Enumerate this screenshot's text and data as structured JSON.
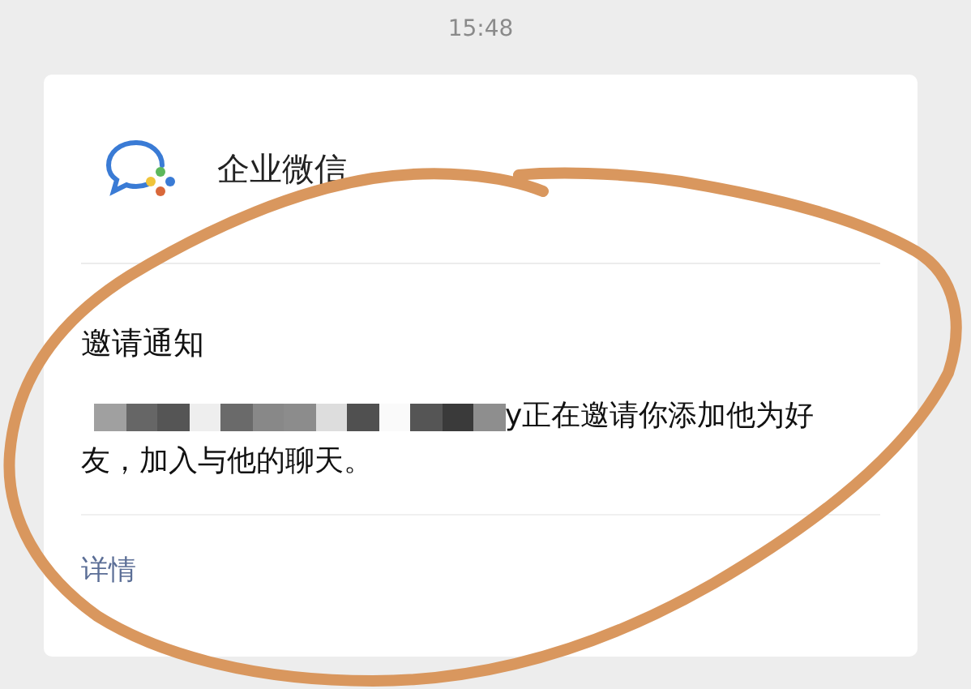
{
  "time": "15:48",
  "card": {
    "app_name": "企业微信",
    "title": "邀请通知",
    "message_lines": [
      "y正在邀请你添加他为好",
      "友，加入与他的聊天。"
    ],
    "link": "详情"
  }
}
